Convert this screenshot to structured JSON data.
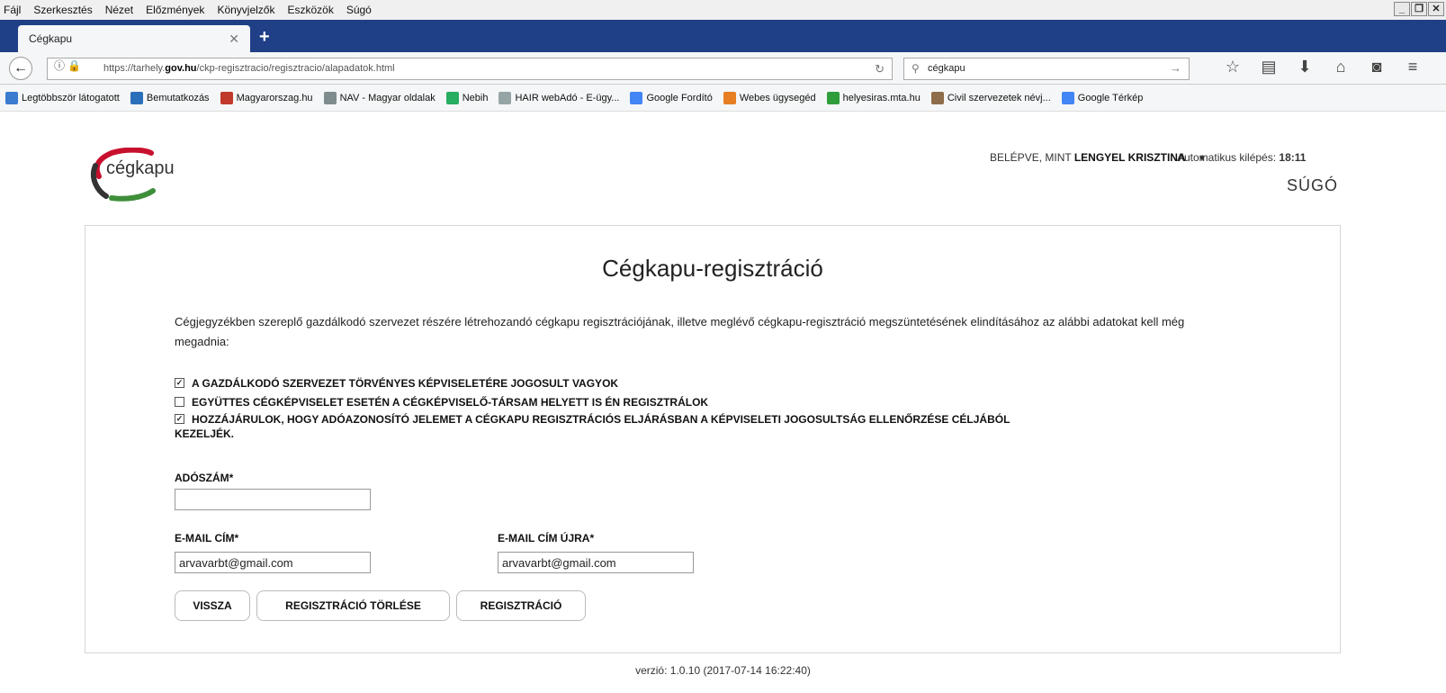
{
  "browser": {
    "menu": [
      "Fájl",
      "Szerkesztés",
      "Nézet",
      "Előzmények",
      "Könyvjelzők",
      "Eszközök",
      "Súgó"
    ],
    "tab_title": "Cégkapu",
    "url_prefix": "https://tarhely.",
    "url_domain": "gov.hu",
    "url_path": "/ckp-regisztracio/regisztracio/alapadatok.html",
    "search_value": "cégkapu",
    "bookmarks": [
      {
        "label": "Legtöbbször látogatott",
        "color": "#3b7ccf"
      },
      {
        "label": "Bemutatkozás",
        "color": "#2a6fba"
      },
      {
        "label": "Magyarorszag.hu",
        "color": "#c0392b"
      },
      {
        "label": "NAV - Magyar oldalak",
        "color": "#7f8c8d"
      },
      {
        "label": "Nebih",
        "color": "#27ae60"
      },
      {
        "label": "HAIR webAdó - E-ügy...",
        "color": "#95a5a6"
      },
      {
        "label": "Google Fordító",
        "color": "#4285f4"
      },
      {
        "label": "Webes ügysegéd",
        "color": "#e67e22"
      },
      {
        "label": "helyesiras.mta.hu",
        "color": "#2e9d3a"
      },
      {
        "label": "Civil szervezetek névj...",
        "color": "#8e6d4a"
      },
      {
        "label": "Google Térkép",
        "color": "#4285f4"
      }
    ]
  },
  "header": {
    "logged_in_prefix": "BELÉPVE, MINT",
    "user_name": "LENGYEL KRISZTINA",
    "autologout_label": "Automatikus kilépés:",
    "autologout_time": "18:11",
    "logo_text": "cégkapu",
    "help": "SÚGÓ"
  },
  "form": {
    "title": "Cégkapu-regisztráció",
    "intro": "Cégjegyzékben szereplő gazdálkodó szervezet részére létrehozandó cégkapu regisztrációjának, illetve meglévő cégkapu-regisztráció megszüntetésének elindításához az alábbi adatokat kell még megadnia:",
    "checkboxes": [
      {
        "label": "A GAZDÁLKODÓ SZERVEZET TÖRVÉNYES KÉPVISELETÉRE JOGOSULT VAGYOK",
        "checked": true
      },
      {
        "label": "EGYÜTTES CÉGKÉPVISELET ESETÉN A CÉGKÉPVISELŐ-TÁRSAM HELYETT IS ÉN REGISZTRÁLOK",
        "checked": false
      },
      {
        "label": "HOZZÁJÁRULOK, HOGY ADÓAZONOSÍTÓ JELEMET A CÉGKAPU REGISZTRÁCIÓS ELJÁRÁSBAN A KÉPVISELETI JOGOSULTSÁG ELLENŐRZÉSE CÉLJÁBÓL",
        "label_cont": "KEZELJÉK.",
        "checked": true
      }
    ],
    "tax_label": "ADÓSZÁM*",
    "tax_value": "",
    "email_label": "E-MAIL CÍM*",
    "email_value": "arvavarbt@gmail.com",
    "email2_label": "E-MAIL CÍM ÚJRA*",
    "email2_value": "arvavarbt@gmail.com",
    "buttons": {
      "back": "VISSZA",
      "delete": "REGISZTRÁCIÓ TÖRLÉSE",
      "register": "REGISZTRÁCIÓ"
    }
  },
  "footer": {
    "version": "verzió: 1.0.10 (2017-07-14 16:22:40)"
  }
}
